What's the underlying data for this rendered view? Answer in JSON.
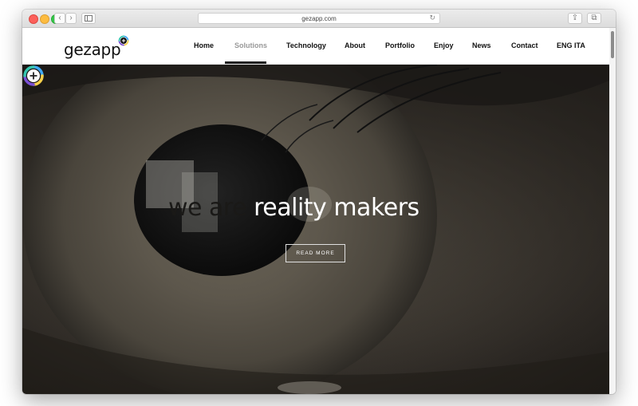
{
  "browser": {
    "url": "gezapp.com",
    "back_glyph": "‹",
    "forward_glyph": "›",
    "reload_glyph": "↻",
    "share_glyph": "⇪",
    "tabs_glyph": "⧉",
    "new_tab_glyph": "+"
  },
  "site": {
    "logo_text": "gezapp",
    "nav": [
      "Home",
      "Solutions",
      "Technology",
      "About",
      "Portfolio",
      "Enjoy",
      "News",
      "Contact"
    ],
    "active_nav": "Solutions",
    "lang": [
      "ENG",
      "ITA"
    ]
  },
  "hero": {
    "headline_dark": "we are ",
    "headline_light": "reality makers",
    "button": "READ MORE"
  },
  "colors": {
    "mark_blue": "#3fa9f5",
    "mark_yellow": "#f7d04a",
    "mark_purple": "#7b4fd6",
    "mark_teal": "#35c6b0"
  }
}
